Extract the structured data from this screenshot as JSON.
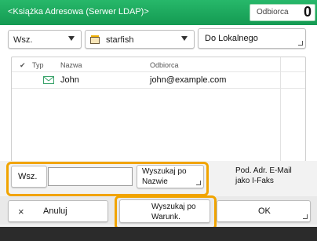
{
  "header": {
    "title": "<Książka Adresowa (Serwer LDAP)>",
    "recipients_label": "Odbiorca",
    "recipients_count": "0"
  },
  "toolbar": {
    "filter_value": "Wsz.",
    "address_book_value": "starfish",
    "to_local_label": "Do Lokalnego"
  },
  "list": {
    "headers": {
      "check": "✔",
      "type": "Typ",
      "name": "Nazwa",
      "recipient": "Odbiorca"
    },
    "rows": [
      {
        "name": "John",
        "recipient": "john@example.com"
      }
    ]
  },
  "search": {
    "prefix_label": "Wsz.",
    "input_value": "",
    "by_name_label_line1": "Wyszukaj po",
    "by_name_label_line2": "Nazwie",
    "info_line1": "Pod. Adr. E-Mail",
    "info_line2": "jako I-Faks"
  },
  "actions": {
    "cancel_label": "Anuluj",
    "search_conditions_line1": "Wyszukaj po",
    "search_conditions_line2": "Warunk.",
    "ok_label": "OK"
  },
  "icons": {
    "cancel": "close-icon",
    "list_item": "email-icon",
    "address_book": "book-icon"
  },
  "colors": {
    "accent_green": "#1aa85c",
    "highlight_orange": "#f1a400"
  }
}
